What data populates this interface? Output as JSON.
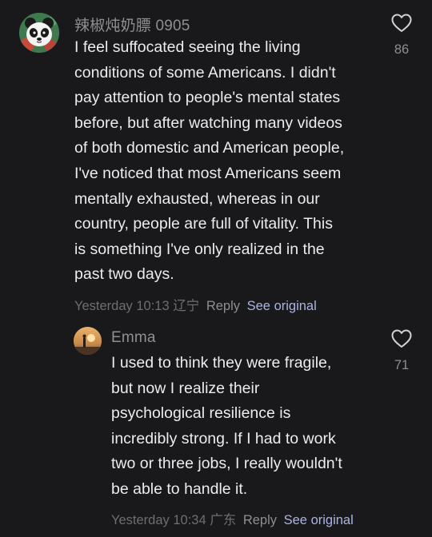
{
  "comments": [
    {
      "username": "辣椒炖奶膘 0905",
      "lines": [
        "I feel suffocated seeing the living",
        "conditions of some Americans. I didn't",
        "pay attention to people's mental states",
        "before, but after watching many videos",
        "of both domestic and American people,",
        "I've noticed that most Americans seem",
        "mentally exhausted, whereas in our",
        "country, people are full of vitality. This",
        "is something I've only realized in the",
        "past two days."
      ],
      "timestamp": "Yesterday 10:13",
      "location": "辽宁",
      "reply_label": "Reply",
      "see_original_label": "See original",
      "likes": "86",
      "avatar_icon": "panda-avatar",
      "like_icon": "heart-outline-icon"
    },
    {
      "username": "Emma",
      "lines": [
        "I used to think they were fragile,",
        "but now I realize their",
        "psychological resilience is",
        "incredibly strong. If I had to work",
        "two or three jobs, I really wouldn't",
        "be able to handle it."
      ],
      "timestamp": "Yesterday 10:34",
      "location": "广东",
      "reply_label": "Reply",
      "see_original_label": "See original",
      "likes": "71",
      "avatar_icon": "sunset-avatar",
      "like_icon": "heart-outline-icon"
    }
  ],
  "colors": {
    "background": "#19191b",
    "text": "#ececee",
    "muted": "#8e8e93",
    "link": "#aab4e3"
  }
}
